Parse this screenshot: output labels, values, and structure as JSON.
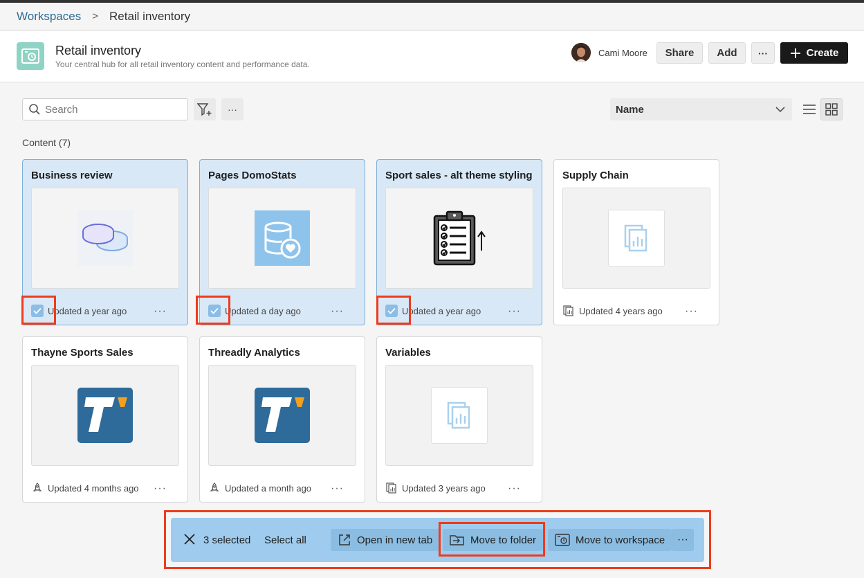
{
  "breadcrumb": {
    "root": "Workspaces",
    "separator": ">",
    "current": "Retail inventory"
  },
  "header": {
    "title": "Retail inventory",
    "subtitle": "Your central hub for all retail inventory content and performance data.",
    "user_name": "Cami Moore",
    "share_label": "Share",
    "add_label": "Add",
    "more_label": "···",
    "create_label": "Create"
  },
  "toolbar": {
    "search_placeholder": "Search",
    "more_label": "···",
    "sort_value": "Name"
  },
  "content_label": "Content (7)",
  "cards": [
    {
      "title": "Business review",
      "updated": "Updated a year ago",
      "selected": true,
      "thumb": "coins-icon"
    },
    {
      "title": "Pages DomoStats",
      "updated": "Updated a day ago",
      "selected": true,
      "thumb": "database-heart-icon"
    },
    {
      "title": "Sport sales - alt theme styling",
      "updated": "Updated a year ago",
      "selected": true,
      "thumb": "clipboard-checklist-icon"
    },
    {
      "title": "Supply Chain",
      "updated": "Updated 4 years ago",
      "selected": false,
      "thumb": "report-icon"
    },
    {
      "title": "Thayne Sports Sales",
      "updated": "Updated 4 months ago",
      "selected": false,
      "thumb": "t-logo-icon"
    },
    {
      "title": "Threadly Analytics",
      "updated": "Updated a month ago",
      "selected": false,
      "thumb": "t-logo-icon"
    },
    {
      "title": "Variables",
      "updated": "Updated 3 years ago",
      "selected": false,
      "thumb": "report-icon"
    }
  ],
  "card_more_label": "···",
  "action_bar": {
    "count": "3 selected",
    "select_all": "Select all",
    "open_new_tab": "Open in new tab",
    "move_to_folder": "Move to folder",
    "move_to_workspace": "Move to workspace",
    "more_label": "···"
  },
  "colors": {
    "selection": "#d8e8f6",
    "highlight": "#ee3b1c",
    "action_bar": "#9fccee",
    "brand_blue": "#2e6b9a",
    "logo_orange": "#f2a01e"
  }
}
